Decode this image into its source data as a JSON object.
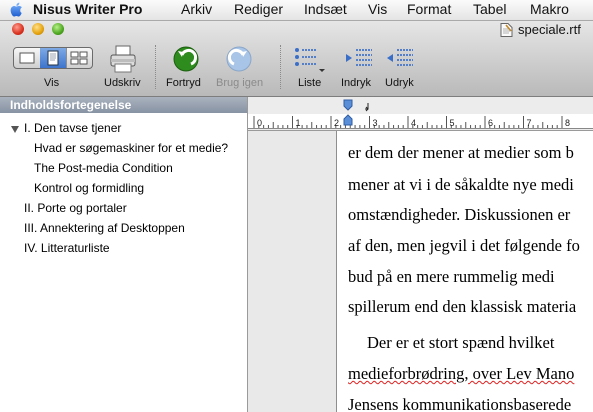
{
  "menubar": {
    "app": "Nisus Writer Pro",
    "items": [
      "Arkiv",
      "Rediger",
      "Indsæt",
      "Vis",
      "Format",
      "Tabel",
      "Makro"
    ]
  },
  "window": {
    "title": "speciale.rtf"
  },
  "toolbar": {
    "vis": "Vis",
    "udskriv": "Udskriv",
    "fortryd": "Fortryd",
    "brug_igen": "Brug igen",
    "liste": "Liste",
    "indryk": "Indryk",
    "udryk": "Udryk"
  },
  "sidebar": {
    "header": "Indholdsfortegenelse",
    "items": [
      "I. Den tavse tjener",
      "Hvad er søgemaskiner for et medie?",
      "The Post-media Condition",
      "Kontrol og formidling",
      "II. Porte og portaler",
      "III. Annektering af Desktoppen",
      "IV. Litteraturliste"
    ]
  },
  "ruler": {
    "numbers": [
      "0",
      "1",
      "2",
      "3",
      "4",
      "5",
      "6",
      "7",
      "8"
    ]
  },
  "document": {
    "lines": [
      "er dem der mener at medier som b",
      "mener at vi i de såkaldte nye medi",
      "omstændigheder. Diskussionen er",
      "af den, men jegvil i det følgende fo",
      "bud på en mere rummelig medi",
      "spillerum end den klassisk materia",
      "Der er et stort spænd hvilket",
      "medieforbrødring, over Lev Mano",
      "Jensens kommunikationsbaserede"
    ]
  },
  "colors": {
    "sidebar_header": "#8f9aab",
    "selected_segment": "#3d74cb",
    "undo_green": "#2e8b1d",
    "redo_blue_disabled": "#a8c4e6"
  }
}
